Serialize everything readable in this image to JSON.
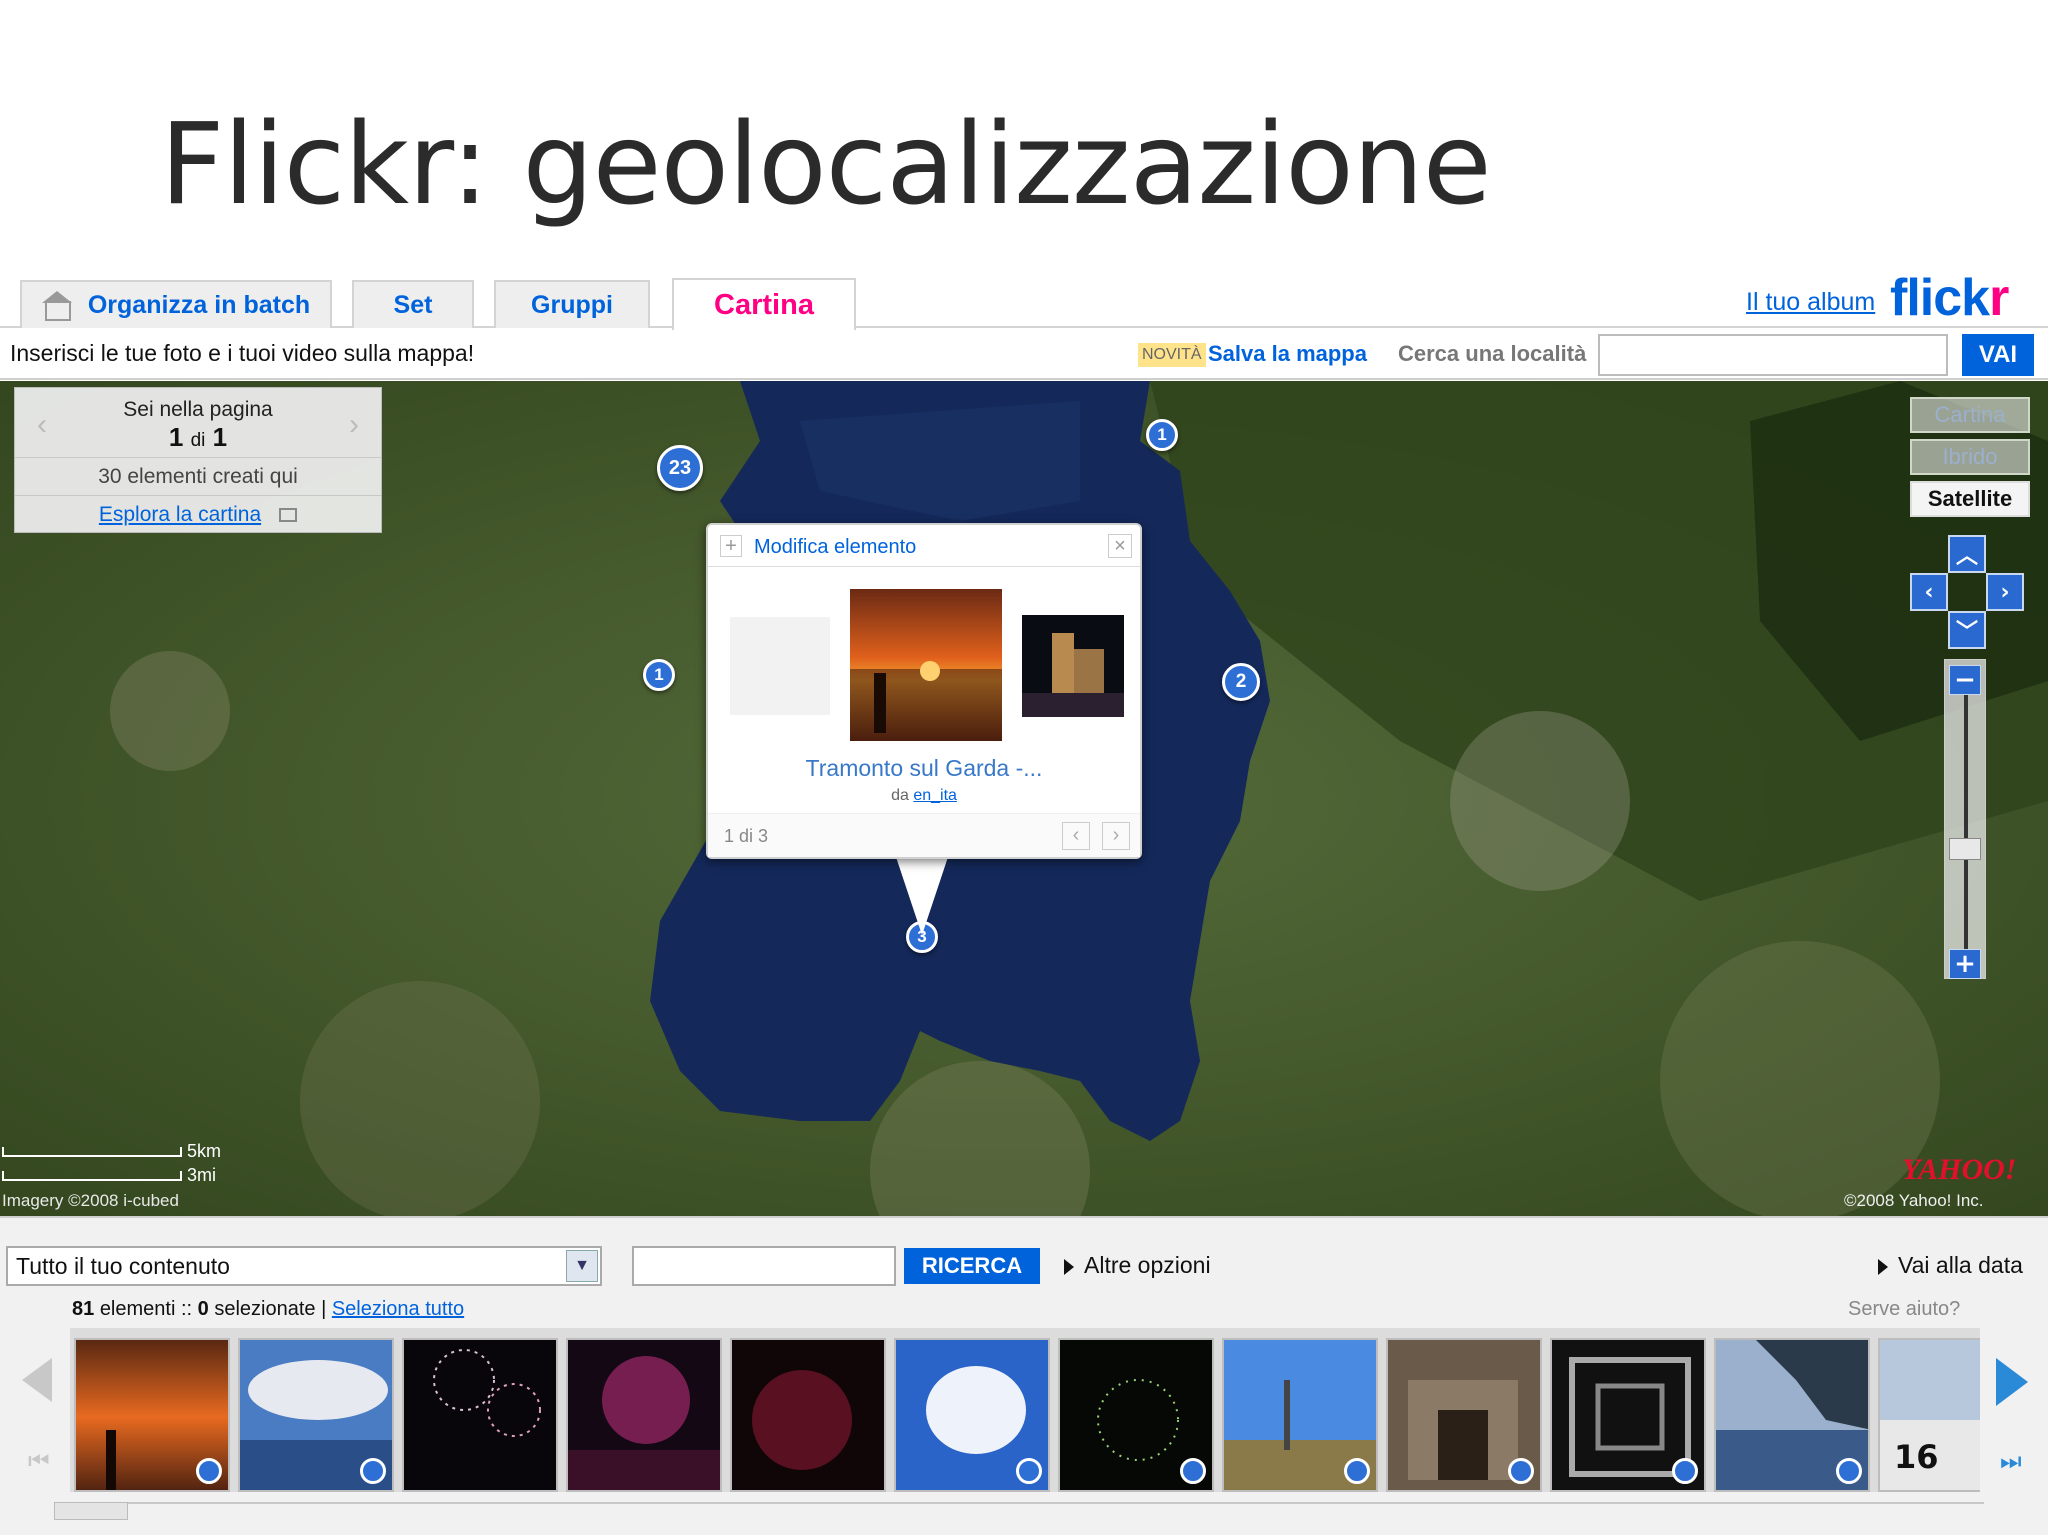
{
  "slide": {
    "title": "Flickr: geolocalizzazione"
  },
  "tabs": [
    {
      "label": "Organizza in batch",
      "active": false
    },
    {
      "label": "Set",
      "active": false
    },
    {
      "label": "Gruppi",
      "active": false
    },
    {
      "label": "Cartina",
      "active": true
    }
  ],
  "header": {
    "album_link": "Il tuo album",
    "logo_part1": "flickr",
    "logo_part2": ""
  },
  "info": {
    "text": "Inserisci le tue foto e i tuoi video sulla mappa!",
    "new_badge": "NOVITÀ",
    "save_map": "Salva la mappa",
    "search_label": "Cerca una località",
    "search_value": "",
    "go_button": "VAI"
  },
  "page_panel": {
    "line1": "Sei nella pagina",
    "current": "1",
    "of": "di",
    "total": "1",
    "items_here": "30 elementi creati qui",
    "explore_link": "Esplora la cartina"
  },
  "markers": [
    "23",
    "1",
    "1",
    "2",
    "3"
  ],
  "popup": {
    "title": "Modifica elemento",
    "caption": "Tramonto sul Garda -...",
    "by_prefix": "da",
    "by_user": "en_ita",
    "counter": "1 di 3"
  },
  "map_types": [
    "Cartina",
    "Ibrido",
    "Satellite"
  ],
  "map_type_selected": "Satellite",
  "scale": {
    "km": "5km",
    "mi": "3mi"
  },
  "imagery": "Imagery ©2008 i-cubed",
  "yahoo": {
    "logo": "YAHOO!",
    "copyright": "©2008 Yahoo! Inc."
  },
  "bottom": {
    "content_filter": "Tutto il tuo contenuto",
    "search_value": "",
    "search_button": "RICERCA",
    "more_options": "Altre opzioni",
    "go_to_date": "Vai alla data",
    "count_total": "81",
    "count_elements_label": "elementi ::",
    "count_selected": "0",
    "count_selected_label": "selezionate |",
    "select_all": "Seleziona tutto",
    "help": "Serve aiuto?",
    "last_thumb_number": "16"
  },
  "colors": {
    "flickr_blue": "#0063dc",
    "flickr_pink": "#ff0084",
    "lake": "#142a5a",
    "marker": "#2e6fd6"
  }
}
